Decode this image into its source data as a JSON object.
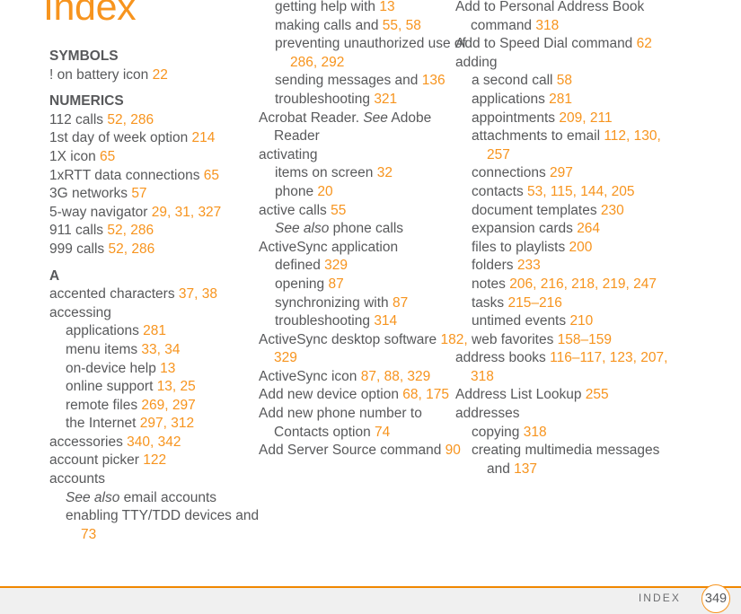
{
  "page": {
    "title": "Index",
    "footer_label": "INDEX",
    "page_number": "349",
    "accent_color": "#F7941E",
    "text_color": "#58595B",
    "rule_color": "#F08700",
    "footer_bg": "#F0F0F0"
  },
  "columns": [
    {
      "id": "col-1",
      "blocks": [
        {
          "type": "section",
          "label": "SYMBOLS",
          "spaced": false
        },
        {
          "type": "entry",
          "level": 0,
          "text": "! on battery icon ",
          "pages": "22"
        },
        {
          "type": "section",
          "label": "NUMERICS",
          "spaced": true
        },
        {
          "type": "entry",
          "level": 0,
          "text": "112 calls ",
          "pages": "52, 286"
        },
        {
          "type": "entry",
          "level": 0,
          "text": "1st day of week option ",
          "pages": "214"
        },
        {
          "type": "entry",
          "level": 0,
          "text": "1X icon ",
          "pages": "65"
        },
        {
          "type": "entry",
          "level": 0,
          "text": "1xRTT data connections ",
          "pages": "65"
        },
        {
          "type": "entry",
          "level": 0,
          "text": "3G networks ",
          "pages": "57"
        },
        {
          "type": "entry",
          "level": 0,
          "text": "5-way navigator ",
          "pages": "29, 31, 327"
        },
        {
          "type": "entry",
          "level": 0,
          "text": "911 calls ",
          "pages": "52, 286"
        },
        {
          "type": "entry",
          "level": 0,
          "text": "999 calls ",
          "pages": "52, 286"
        },
        {
          "type": "section",
          "label": "A",
          "spaced": true
        },
        {
          "type": "entry",
          "level": 0,
          "text": "accented characters ",
          "pages": "37, 38"
        },
        {
          "type": "entry",
          "level": 0,
          "text": "accessing",
          "pages": ""
        },
        {
          "type": "entry",
          "level": 1,
          "text": "applications ",
          "pages": "281"
        },
        {
          "type": "entry",
          "level": 1,
          "text": "menu items ",
          "pages": "33, 34"
        },
        {
          "type": "entry",
          "level": 1,
          "text": "on-device help ",
          "pages": "13"
        },
        {
          "type": "entry",
          "level": 1,
          "text": "online support ",
          "pages": "13, 25"
        },
        {
          "type": "entry",
          "level": 1,
          "text": "remote files ",
          "pages": "269, 297"
        },
        {
          "type": "entry",
          "level": 1,
          "text": "the Internet ",
          "pages": "297, 312"
        },
        {
          "type": "entry",
          "level": 0,
          "text": "accessories ",
          "pages": "340, 342"
        },
        {
          "type": "entry",
          "level": 0,
          "text": "account picker ",
          "pages": "122"
        },
        {
          "type": "entry",
          "level": 0,
          "text": "accounts",
          "pages": ""
        },
        {
          "type": "entry",
          "level": 1,
          "see": "See also",
          "text": " email accounts",
          "pages": ""
        },
        {
          "type": "entry",
          "level": 1,
          "text": "enabling TTY/TDD devices and ",
          "pages": "73"
        }
      ]
    },
    {
      "id": "col-2",
      "blocks": [
        {
          "type": "entry",
          "level": 1,
          "text": "getting help with ",
          "pages": "13"
        },
        {
          "type": "entry",
          "level": 1,
          "text": "making calls and ",
          "pages": "55, 58"
        },
        {
          "type": "entry",
          "level": 1,
          "text": "preventing unauthorized use of ",
          "pages": "286, 292"
        },
        {
          "type": "entry",
          "level": 1,
          "text": "sending messages and ",
          "pages": "136"
        },
        {
          "type": "entry",
          "level": 1,
          "text": "troubleshooting ",
          "pages": "321"
        },
        {
          "type": "entry",
          "level": 0,
          "text": "Acrobat Reader. ",
          "see": "See",
          "text2": " Adobe Reader",
          "pages": ""
        },
        {
          "type": "entry",
          "level": 0,
          "text": "activating",
          "pages": ""
        },
        {
          "type": "entry",
          "level": 1,
          "text": "items on screen ",
          "pages": "32"
        },
        {
          "type": "entry",
          "level": 1,
          "text": "phone ",
          "pages": "20"
        },
        {
          "type": "entry",
          "level": 0,
          "text": "active calls ",
          "pages": "55"
        },
        {
          "type": "entry",
          "level": 1,
          "see": "See also",
          "text": " phone calls",
          "pages": ""
        },
        {
          "type": "entry",
          "level": 0,
          "text": "ActiveSync application",
          "pages": ""
        },
        {
          "type": "entry",
          "level": 1,
          "text": "defined ",
          "pages": "329"
        },
        {
          "type": "entry",
          "level": 1,
          "text": "opening ",
          "pages": "87"
        },
        {
          "type": "entry",
          "level": 1,
          "text": "synchronizing with ",
          "pages": "87"
        },
        {
          "type": "entry",
          "level": 1,
          "text": "troubleshooting ",
          "pages": "314"
        },
        {
          "type": "entry",
          "level": 0,
          "text": "ActiveSync desktop software ",
          "pages": "182, 329"
        },
        {
          "type": "entry",
          "level": 0,
          "text": "ActiveSync icon ",
          "pages": "87, 88, 329"
        },
        {
          "type": "entry",
          "level": 0,
          "text": "Add new device option ",
          "pages": "68, 175"
        },
        {
          "type": "entry",
          "level": 0,
          "text": "Add new phone number to Contacts option ",
          "pages": "74"
        },
        {
          "type": "entry",
          "level": 0,
          "text": "Add Server Source command ",
          "pages": "90"
        }
      ]
    },
    {
      "id": "col-3",
      "blocks": [
        {
          "type": "entry",
          "level": 0,
          "text": "Add to Personal Address Book command ",
          "pages": "318"
        },
        {
          "type": "entry",
          "level": 0,
          "text": "Add to Speed Dial command ",
          "pages": "62"
        },
        {
          "type": "entry",
          "level": 0,
          "text": "adding",
          "pages": ""
        },
        {
          "type": "entry",
          "level": 1,
          "text": "a second call ",
          "pages": "58"
        },
        {
          "type": "entry",
          "level": 1,
          "text": "applications ",
          "pages": "281"
        },
        {
          "type": "entry",
          "level": 1,
          "text": "appointments ",
          "pages": "209, 211"
        },
        {
          "type": "entry",
          "level": 1,
          "text": "attachments to email ",
          "pages": "112, 130, 257"
        },
        {
          "type": "entry",
          "level": 1,
          "text": "connections ",
          "pages": "297"
        },
        {
          "type": "entry",
          "level": 1,
          "text": "contacts ",
          "pages": "53, 115, 144, 205"
        },
        {
          "type": "entry",
          "level": 1,
          "text": "document templates ",
          "pages": "230"
        },
        {
          "type": "entry",
          "level": 1,
          "text": "expansion cards ",
          "pages": "264"
        },
        {
          "type": "entry",
          "level": 1,
          "text": "files to playlists ",
          "pages": "200"
        },
        {
          "type": "entry",
          "level": 1,
          "text": "folders ",
          "pages": "233"
        },
        {
          "type": "entry",
          "level": 1,
          "text": "notes ",
          "pages": "206, 216, 218, 219, 247"
        },
        {
          "type": "entry",
          "level": 1,
          "text": "tasks ",
          "pages": "215–216"
        },
        {
          "type": "entry",
          "level": 1,
          "text": "untimed events ",
          "pages": "210"
        },
        {
          "type": "entry",
          "level": 1,
          "text": "web favorites ",
          "pages": "158–159"
        },
        {
          "type": "entry",
          "level": 0,
          "text": "address books ",
          "pages": "116–117, 123, 207, 318"
        },
        {
          "type": "entry",
          "level": 0,
          "text": "Address List Lookup ",
          "pages": "255"
        },
        {
          "type": "entry",
          "level": 0,
          "text": "addresses",
          "pages": ""
        },
        {
          "type": "entry",
          "level": 1,
          "text": "copying ",
          "pages": "318"
        },
        {
          "type": "entry",
          "level": 1,
          "text": "creating multimedia messages and ",
          "pages": "137"
        }
      ]
    }
  ]
}
